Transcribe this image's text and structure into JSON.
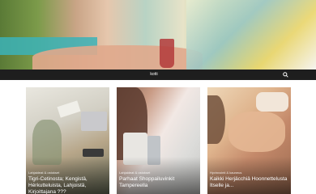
{
  "search": {
    "query": "kotti"
  },
  "cards": [
    {
      "category": "Lahjaideat & ostokset",
      "title": "Tigri-Cetinosta; Kengistä, Hérkutteluista, Lahjoistä, Kirjoittajana ???"
    },
    {
      "category": "Lahjaideat & ostokset",
      "title": "Parhaat Shoppailuvinkit Tampereella"
    },
    {
      "category": "Hyvinvointi & kauneus",
      "title": "Kaikki Herjäcchiä Hoonnettelusta Itselle ja..."
    }
  ],
  "colors": {
    "searchbar": "#1e1e1e",
    "text": "#ffffff"
  }
}
